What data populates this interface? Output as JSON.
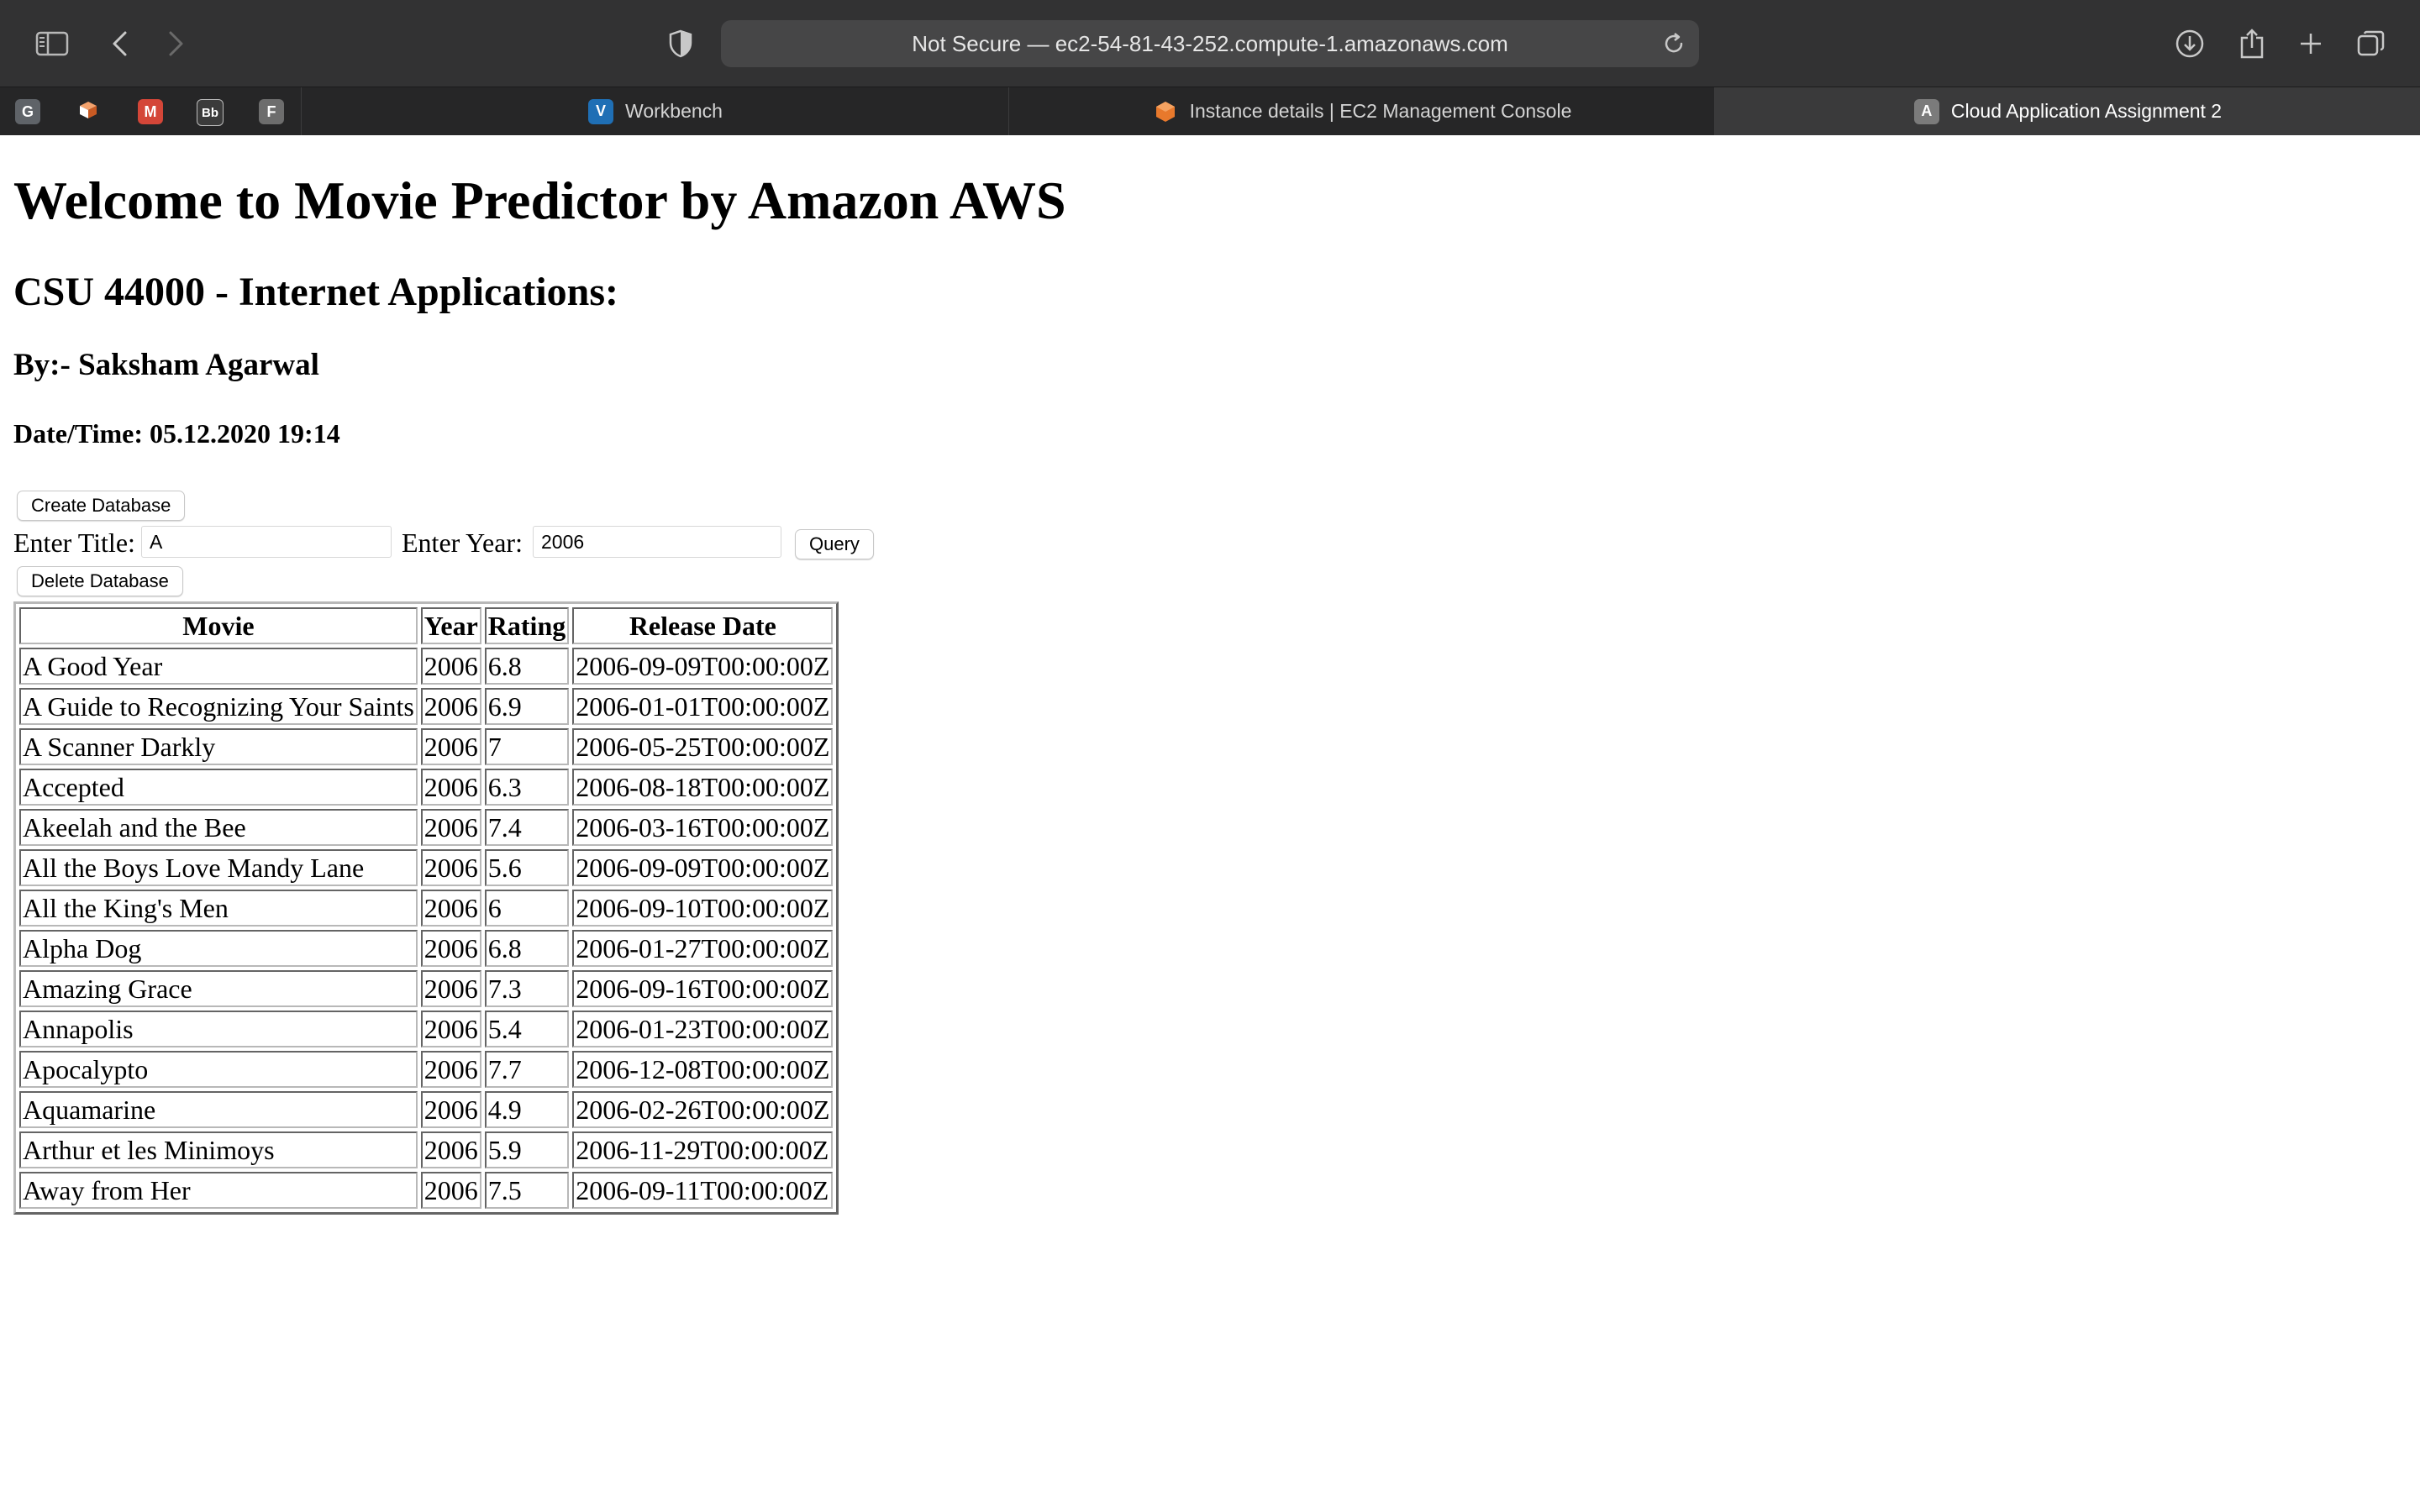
{
  "browser": {
    "address": "Not Secure — ec2-54-81-43-252.compute-1.amazonaws.com",
    "pinned_tabs": [
      {
        "icon": "google-favicon",
        "letter": "G",
        "color": "#5f6368"
      },
      {
        "icon": "box-favicon",
        "letter": "",
        "color": "#e9743b"
      },
      {
        "icon": "gmail-favicon",
        "letter": "M",
        "color": "#d44638"
      },
      {
        "icon": "blackboard-favicon",
        "letter": "Bb",
        "color": "#3b3b3b"
      },
      {
        "icon": "f-favicon",
        "letter": "F",
        "color": "#6d6d6d"
      }
    ],
    "tabs": [
      {
        "label": "Workbench",
        "icon": "vocareum-favicon",
        "icon_letter": "V",
        "icon_color": "#1f6fb5"
      },
      {
        "label": "Instance details | EC2 Management Console",
        "icon": "aws-ec2-favicon",
        "icon_letter": "",
        "icon_color": "#e8792c"
      },
      {
        "label": "Cloud Application Assignment 2",
        "icon": "a-favicon",
        "icon_letter": "A",
        "icon_color": "#7b7b7b"
      }
    ],
    "icons": {
      "sidebar": "sidebar-icon",
      "back": "chevron-left-icon",
      "forward": "chevron-right-icon",
      "privacy": "shield-icon",
      "reload": "reload-icon",
      "downloads": "download-icon",
      "share": "share-icon",
      "new_tab": "plus-icon",
      "tab_overview": "tabs-overview-icon"
    }
  },
  "page": {
    "title": "Welcome to Movie Predictor by Amazon AWS",
    "course": "CSU 44000 - Internet Applications:",
    "author": "By:- Saksham Agarwal",
    "datetime": "Date/Time: 05.12.2020 19:14",
    "create_button": "Create Database",
    "delete_button": "Delete Database",
    "query_button": "Query",
    "title_label": "Enter Title:",
    "title_value": "A",
    "year_label": "Enter Year:",
    "year_value": "2006"
  },
  "table": {
    "headers": [
      "Movie",
      "Year",
      "Rating",
      "Release Date"
    ],
    "rows": [
      [
        "A Good Year",
        "2006",
        "6.8",
        "2006-09-09T00:00:00Z"
      ],
      [
        "A Guide to Recognizing Your Saints",
        "2006",
        "6.9",
        "2006-01-01T00:00:00Z"
      ],
      [
        "A Scanner Darkly",
        "2006",
        "7",
        "2006-05-25T00:00:00Z"
      ],
      [
        "Accepted",
        "2006",
        "6.3",
        "2006-08-18T00:00:00Z"
      ],
      [
        "Akeelah and the Bee",
        "2006",
        "7.4",
        "2006-03-16T00:00:00Z"
      ],
      [
        "All the Boys Love Mandy Lane",
        "2006",
        "5.6",
        "2006-09-09T00:00:00Z"
      ],
      [
        "All the King's Men",
        "2006",
        "6",
        "2006-09-10T00:00:00Z"
      ],
      [
        "Alpha Dog",
        "2006",
        "6.8",
        "2006-01-27T00:00:00Z"
      ],
      [
        "Amazing Grace",
        "2006",
        "7.3",
        "2006-09-16T00:00:00Z"
      ],
      [
        "Annapolis",
        "2006",
        "5.4",
        "2006-01-23T00:00:00Z"
      ],
      [
        "Apocalypto",
        "2006",
        "7.7",
        "2006-12-08T00:00:00Z"
      ],
      [
        "Aquamarine",
        "2006",
        "4.9",
        "2006-02-26T00:00:00Z"
      ],
      [
        "Arthur et les Minimoys",
        "2006",
        "5.9",
        "2006-11-29T00:00:00Z"
      ],
      [
        "Away from Her",
        "2006",
        "7.5",
        "2006-09-11T00:00:00Z"
      ]
    ]
  }
}
